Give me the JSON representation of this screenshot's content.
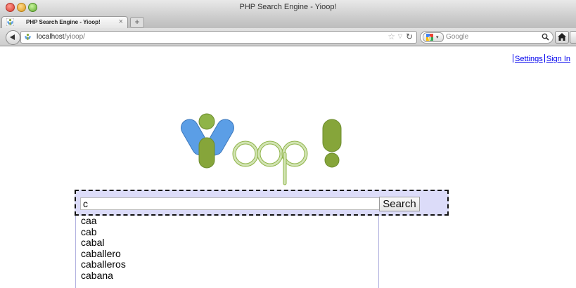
{
  "window": {
    "title": "PHP Search Engine - Yioop!"
  },
  "tab": {
    "title": "PHP Search Engine - Yioop!",
    "close": "×",
    "new_tab": "+"
  },
  "nav": {
    "url_host": "localhost",
    "url_path": "/yioop/",
    "search_engine": "Google"
  },
  "header_links": {
    "settings": "Settings",
    "sign_in": "Sign In"
  },
  "search": {
    "query": "c",
    "button_label": "Search"
  },
  "suggestions": [
    "caa",
    "cab",
    "cabal",
    "caballero",
    "caballeros",
    "cabana"
  ],
  "colors": {
    "link": "#0000ee",
    "form_bg": "#dcdcf9",
    "logo_blue": "#5b9ee6",
    "logo_green_dark": "#86a53a",
    "logo_green_light": "#c6dca2"
  },
  "icons": [
    "yioop-favicon",
    "back-arrow-icon",
    "star-icon",
    "dropdown-icon",
    "reload-icon",
    "google-icon",
    "magnifier-icon",
    "home-icon"
  ]
}
